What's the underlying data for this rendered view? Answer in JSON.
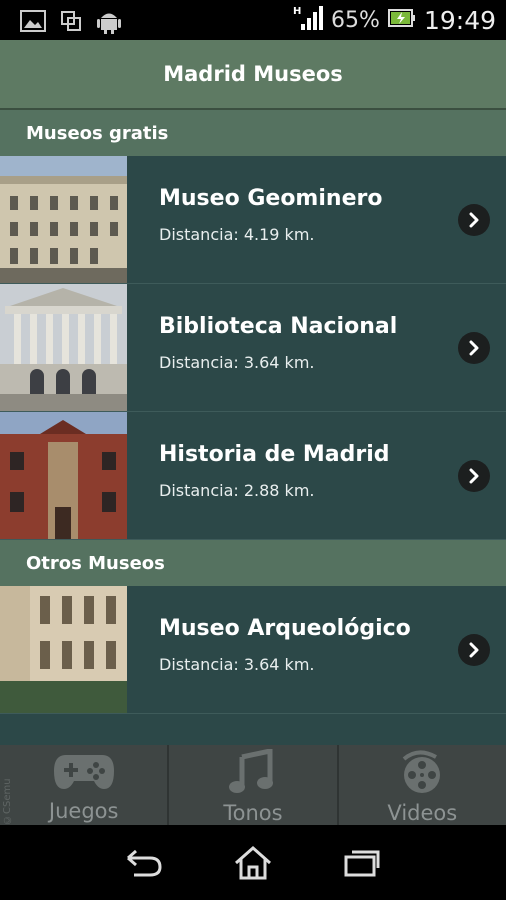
{
  "status_bar": {
    "battery_percent": "65%",
    "time": "19:49",
    "network": "H",
    "icons": [
      "image-icon",
      "copy-icon",
      "android-icon",
      "signal-icon",
      "battery-charging-icon"
    ]
  },
  "header": {
    "title": "Madrid Museos"
  },
  "sections": [
    {
      "title": "Museos gratis",
      "items": [
        {
          "name": "Museo Geominero",
          "distance": "Distancia: 4.19 km."
        },
        {
          "name": "Biblioteca Nacional",
          "distance": "Distancia: 3.64 km."
        },
        {
          "name": "Historia de Madrid",
          "distance": "Distancia: 2.88 km."
        }
      ]
    },
    {
      "title": "Otros Museos",
      "items": [
        {
          "name": "Museo Arqueológico",
          "distance": "Distancia: 3.64 km."
        }
      ]
    }
  ],
  "tabs": [
    {
      "label": "Juegos",
      "icon": "gamepad-icon"
    },
    {
      "label": "Tonos",
      "icon": "music-note-icon"
    },
    {
      "label": "Videos",
      "icon": "film-reel-icon"
    }
  ],
  "watermark": "©CSemu",
  "nav": {
    "icons": [
      "back-icon",
      "home-icon",
      "recents-icon"
    ]
  },
  "colors": {
    "header": "#5e7a63",
    "section": "#557260",
    "row_bg": "#2c4848",
    "tab_bar": "#3f4544"
  }
}
